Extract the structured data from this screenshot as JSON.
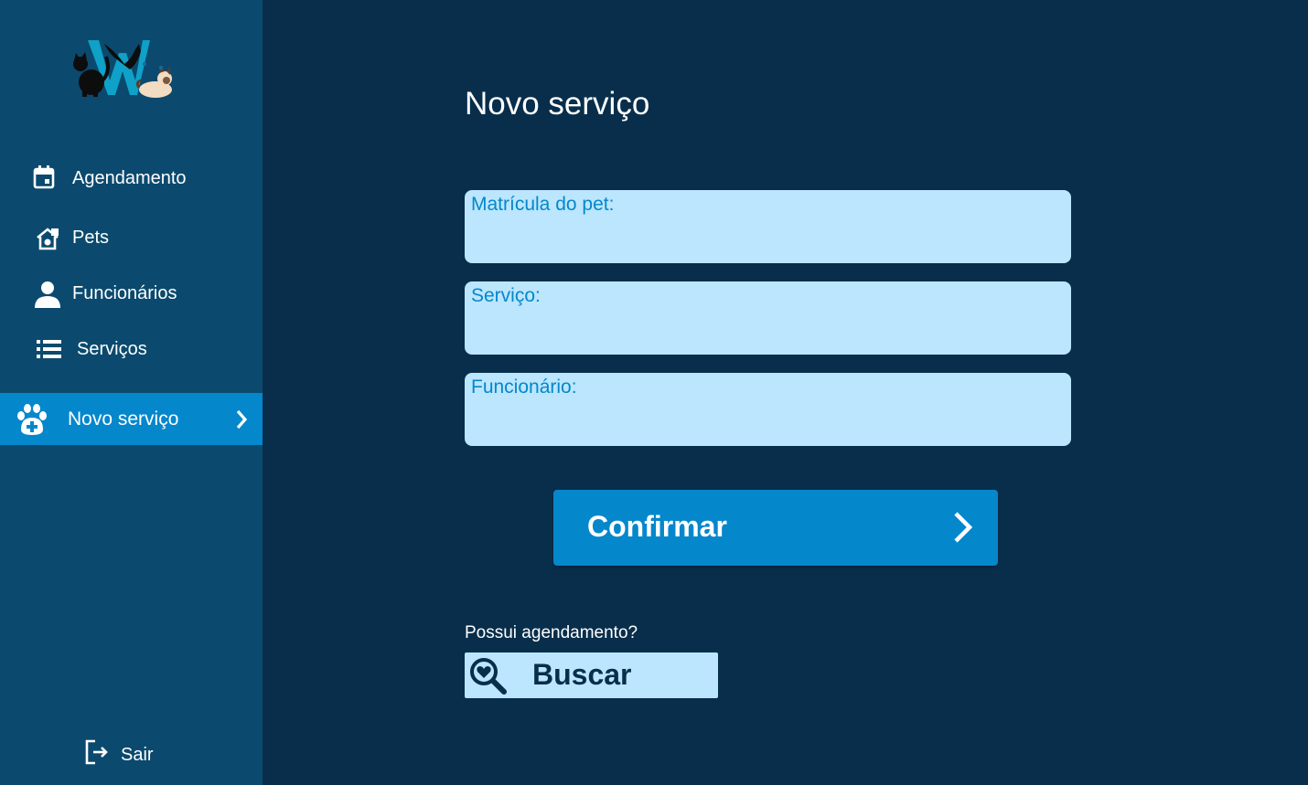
{
  "colors": {
    "background": "#082e4b",
    "sidebar": "#0b4a6e",
    "accent": "#0587cc",
    "field_bg": "#bbe6fd",
    "field_label": "#0587cc"
  },
  "sidebar": {
    "logo_icon": "pet-shop-logo",
    "items": [
      {
        "label": "Agendamento",
        "icon": "calendar-icon"
      },
      {
        "label": "Pets",
        "icon": "pet-house-icon"
      },
      {
        "label": "Funcionários",
        "icon": "person-icon"
      },
      {
        "label": "Serviços",
        "icon": "list-icon"
      },
      {
        "label": "Novo serviço",
        "icon": "paw-plus-icon",
        "active": true
      }
    ],
    "logout": {
      "label": "Sair",
      "icon": "logout-icon"
    }
  },
  "main": {
    "title": "Novo serviço",
    "fields": [
      {
        "label": "Matrícula do pet:",
        "value": ""
      },
      {
        "label": "Serviço:",
        "value": ""
      },
      {
        "label": "Funcionário:",
        "value": ""
      }
    ],
    "confirm_label": "Confirmar",
    "question": "Possui agendamento?",
    "search_label": "Buscar"
  }
}
